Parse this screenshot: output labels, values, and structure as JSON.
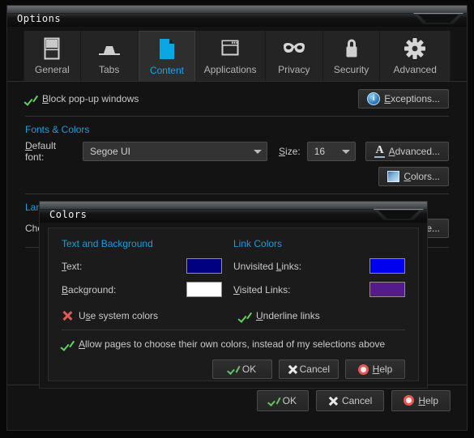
{
  "window": {
    "title": "Options"
  },
  "tabs": [
    {
      "label": "General",
      "icon": "window-split-icon",
      "selected": false
    },
    {
      "label": "Tabs",
      "icon": "tab-icon",
      "selected": false
    },
    {
      "label": "Content",
      "icon": "document-page-icon",
      "selected": true
    },
    {
      "label": "Applications",
      "icon": "app-window-icon",
      "selected": false
    },
    {
      "label": "Privacy",
      "icon": "mask-icon",
      "selected": false
    },
    {
      "label": "Security",
      "icon": "padlock-icon",
      "selected": false
    },
    {
      "label": "Advanced",
      "icon": "gear-icon",
      "selected": false
    }
  ],
  "content": {
    "block_popups": {
      "label": "Block pop-up windows",
      "underline": "B",
      "checked": true,
      "state_icon": "green-check-icon"
    },
    "exceptions_button": {
      "label": "Exceptions...",
      "underline": "E",
      "icon": "info-icon"
    },
    "fonts_colors_heading": "Fonts & Colors",
    "default_font_label": "Default font:",
    "default_font_underline": "D",
    "default_font_value": "Segoe UI",
    "size_label": "Size:",
    "size_underline": "S",
    "size_value": "16",
    "advanced_button": {
      "label": "Advanced...",
      "underline": "A",
      "icon": "font-A-icon"
    },
    "colors_button": {
      "label": "Colors...",
      "underline": "C",
      "icon": "color-palette-icon"
    },
    "languages_heading": "Languages",
    "languages_text_visible": "Cho",
    "choose_button_visible": "se..."
  },
  "colors_dialog": {
    "title": "Colors",
    "text_and_background_heading": "Text and Background",
    "link_colors_heading": "Link Colors",
    "rows_left": [
      {
        "label": "Text:",
        "underline": "T",
        "swatch": "#000080"
      },
      {
        "label": "Background:",
        "underline": "B",
        "swatch": "#FFFFFF"
      }
    ],
    "rows_right": [
      {
        "label": "Unvisited Links:",
        "underline": "L",
        "swatch": "#0000EE"
      },
      {
        "label": "Visited Links:",
        "underline": "V",
        "swatch": "#551A8B"
      }
    ],
    "use_system_colors": {
      "label": "Use system colors",
      "underline": "s",
      "checked": false,
      "state_icon": "red-x-icon"
    },
    "underline_links": {
      "label": "Underline links",
      "underline": "U",
      "checked": true,
      "state_icon": "green-check-icon"
    },
    "allow_pages": {
      "label": "Allow pages to choose their own colors, instead of my selections above",
      "underline": "A",
      "checked": true,
      "state_icon": "green-check-icon"
    },
    "buttons": [
      {
        "label": "OK",
        "underline": "",
        "icon": "check-icon"
      },
      {
        "label": "Cancel",
        "underline": "",
        "icon": "x-icon"
      },
      {
        "label": "Help",
        "underline": "H",
        "icon": "help-ring-icon"
      }
    ]
  },
  "footer_buttons": [
    {
      "label": "OK",
      "underline": "",
      "icon": "check-icon"
    },
    {
      "label": "Cancel",
      "underline": "",
      "icon": "x-icon"
    },
    {
      "label": "Help",
      "underline": "H",
      "icon": "help-ring-icon"
    }
  ],
  "colors": {
    "accent_blue": "#1a9de0",
    "tab_selected_text": "#1aa3e8",
    "check_green": "#5fd35f",
    "cross_red": "#e05a4e",
    "window_bg": "#131313",
    "dialog_bg": "#1b1b1b"
  }
}
